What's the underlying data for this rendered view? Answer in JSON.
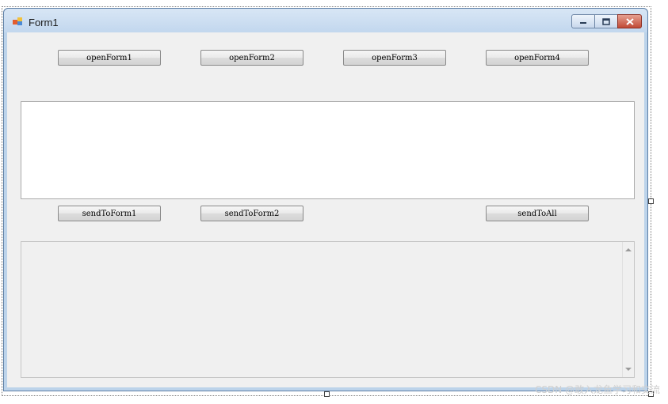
{
  "window": {
    "title": "Form1",
    "icon": "windows-form-icon",
    "caption_buttons": [
      "minimize-icon",
      "restore-icon",
      "close-icon"
    ]
  },
  "buttons": {
    "open": [
      "openForm1",
      "openForm2",
      "openForm3",
      "openForm4"
    ],
    "send": [
      "sendToForm1",
      "sendToForm2",
      "sendToAll"
    ]
  },
  "textbox": {
    "value": ""
  },
  "output": {
    "value": ""
  },
  "watermark": "CSDN @敢入龙鱼学习和交流"
}
